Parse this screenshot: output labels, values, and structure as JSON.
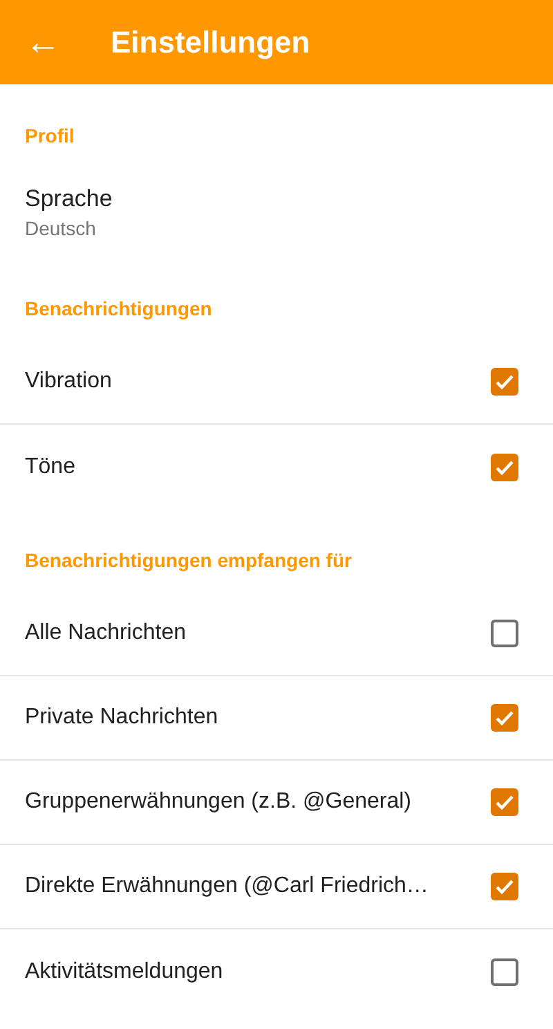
{
  "app_bar": {
    "back_icon": "←",
    "title": "Einstellungen"
  },
  "sections": [
    {
      "title": "Profil",
      "items": [
        {
          "kind": "value",
          "label": "Sprache",
          "value": "Deutsch"
        }
      ]
    },
    {
      "title": "Benachrichtigungen",
      "items": [
        {
          "kind": "checkbox",
          "label": "Vibration",
          "checked": true
        },
        {
          "kind": "checkbox",
          "label": "Töne",
          "checked": true
        }
      ]
    },
    {
      "title": "Benachrichtigungen empfangen für",
      "items": [
        {
          "kind": "checkbox",
          "label": "Alle Nachrichten",
          "checked": false
        },
        {
          "kind": "checkbox",
          "label": "Private Nachrichten",
          "checked": true
        },
        {
          "kind": "checkbox",
          "label": "Gruppenerwähnungen (z.B. @General)",
          "checked": true
        },
        {
          "kind": "checkbox",
          "label": "Direkte Erwähnungen (@Carl Friedrich…",
          "checked": true
        },
        {
          "kind": "checkbox",
          "label": "Aktivitätsmeldungen",
          "checked": false
        }
      ]
    }
  ]
}
